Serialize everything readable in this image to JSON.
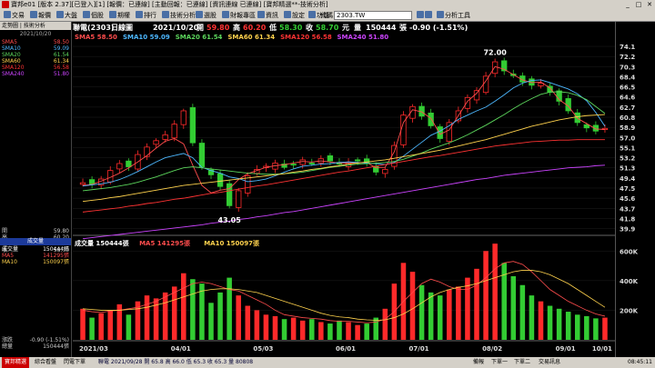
{
  "window": {
    "title": "寶邦e01 [版本 2.37][已登入][1] [報價：已連線] [主動回報：已連線] [資訊連線 已連線] [寶邦精選**-技術分析]"
  },
  "menu": [
    {
      "label": "交易"
    },
    {
      "label": "報價"
    },
    {
      "label": "大盤"
    },
    {
      "label": "個股"
    },
    {
      "label": "期權"
    },
    {
      "label": "排行"
    },
    {
      "label": "技術分析"
    },
    {
      "label": "選股"
    },
    {
      "label": "財報專區"
    },
    {
      "label": "資訊"
    },
    {
      "label": "設定"
    },
    {
      "label": "功能"
    }
  ],
  "toolbar": {
    "code_label": "代碼",
    "symbol_value": "2303.TW",
    "analysis_label": "分析工具"
  },
  "left_panel": {
    "tabs": "走勢圖 | 技術分析",
    "date": "2021/10/20",
    "ma_rows": [
      {
        "label": "SMA5",
        "value": "58.50",
        "color": "#ff4d4d"
      },
      {
        "label": "SMA10",
        "value": "59.09",
        "color": "#4db8ff"
      },
      {
        "label": "SMA20",
        "value": "61.54",
        "color": "#5cd65c"
      },
      {
        "label": "SMA60",
        "value": "61.34",
        "color": "#ffd24d"
      },
      {
        "label": "SMA120",
        "value": "56.58",
        "color": "#ff3333"
      },
      {
        "label": "SMA240",
        "value": "51.80",
        "color": "#cc44ff"
      }
    ],
    "ohlc_rows": [
      {
        "label": "開",
        "value": "59.80"
      },
      {
        "label": "高",
        "value": "60.20"
      },
      {
        "label": "低",
        "value": "58.30"
      },
      {
        "label": "收",
        "value": "58.70"
      }
    ],
    "vol_header": "成交量",
    "vol_rows": [
      {
        "label": "成交量",
        "value": "150444張",
        "color": "#ffffff"
      },
      {
        "label": "MA5",
        "value": "141295張",
        "color": "#ff4d4d"
      },
      {
        "label": "MA10",
        "value": "150097張",
        "color": "#ffd24d"
      }
    ],
    "footer_rows": [
      {
        "label": "漲跌",
        "value": "-0.90 (-1.51%)"
      },
      {
        "label": "總量",
        "value": "150444張"
      }
    ]
  },
  "chart_header": {
    "name": "聯電(2303)",
    "period": "日線圖",
    "date": "2021/10/20",
    "open_label": "開",
    "open": "59.80",
    "high_label": "高",
    "high": "60.20",
    "low_label": "低",
    "low": "58.30",
    "close_label": "收",
    "close": "58.70",
    "unit": "元",
    "vol_label": "量",
    "volume": "150444",
    "chg_label": "張",
    "change": "-0.90 (-1.51%)",
    "ma_legend": [
      {
        "label": "SMA5",
        "value": "58.50",
        "color": "#ff4d4d"
      },
      {
        "label": "SMA10",
        "value": "59.09",
        "color": "#4db8ff"
      },
      {
        "label": "SMA20",
        "value": "61.54",
        "color": "#5cd65c"
      },
      {
        "label": "SMA60",
        "value": "61.34",
        "color": "#ffd24d"
      },
      {
        "label": "SMA120",
        "value": "56.58",
        "color": "#ff3333"
      },
      {
        "label": "SMA240",
        "value": "51.80",
        "color": "#cc44ff"
      }
    ],
    "vol_legend": [
      {
        "label": "成交量",
        "value": "150444",
        "unit": "張",
        "color": "#ffffff"
      },
      {
        "label": "MA5",
        "value": "141295",
        "unit": "張",
        "color": "#ff4d4d"
      },
      {
        "label": "MA10",
        "value": "150097",
        "unit": "張",
        "color": "#ffd24d"
      }
    ]
  },
  "chart_data": [
    {
      "type": "candlestick",
      "yticks": [
        39.9,
        41.8,
        43.7,
        45.6,
        47.5,
        49.4,
        51.3,
        53.2,
        55.1,
        57.0,
        58.9,
        60.8,
        62.7,
        64.6,
        66.5,
        68.4,
        70.3,
        72.2,
        74.1
      ],
      "ylim": [
        38.8,
        75.3
      ],
      "annotations": [
        {
          "label": "72.00",
          "value": 72.0,
          "date": "2021/09/01"
        },
        {
          "label": "43.05",
          "value": 43.05,
          "date": "2021/05/13"
        }
      ],
      "xticks": [
        "2021/03",
        "04/01",
        "05/03",
        "06/01",
        "07/01",
        "08/02",
        "09/01",
        "10/01"
      ],
      "series": [
        {
          "name": "SMA5",
          "values": [
            48.0,
            48.2,
            48.8,
            49.5,
            50.3,
            51.3,
            52.4,
            53.6,
            55.0,
            56.3,
            56.8,
            55.8,
            51.8,
            48.0,
            46.6,
            47.1,
            47.4,
            49.1,
            50.2,
            50.8,
            51.4,
            51.7,
            51.9,
            52.2,
            52.5,
            52.4,
            52.6,
            52.4,
            52.2,
            52.2,
            52.3,
            52.3,
            51.3,
            51.4,
            54.3,
            59.8,
            62.2,
            61.8,
            60.6,
            57.6,
            58.4,
            61.1,
            63.8,
            65.3,
            67.6,
            70.3,
            69.8,
            68.8,
            67.8,
            67.3,
            67.4,
            66.3,
            64.1,
            62.9,
            60.6,
            59.6,
            58.6,
            58.5
          ]
        },
        {
          "name": "SMA10",
          "values": [
            47.9,
            48.1,
            48.3,
            48.6,
            49.1,
            49.8,
            50.6,
            51.5,
            52.4,
            53.2,
            53.6,
            54.0,
            53.2,
            51.4,
            50.8,
            50.3,
            49.6,
            49.3,
            48.7,
            48.9,
            49.2,
            49.8,
            50.5,
            51.1,
            51.6,
            51.8,
            52.0,
            52.1,
            52.3,
            52.4,
            52.3,
            52.2,
            52.1,
            51.9,
            52.3,
            53.5,
            54.8,
            56.1,
            57.4,
            58.2,
            59.2,
            60.4,
            61.2,
            62.0,
            62.7,
            63.8,
            65.0,
            66.3,
            67.2,
            67.7,
            67.8,
            67.3,
            66.7,
            66.1,
            65.2,
            63.9,
            61.7,
            59.1
          ]
        },
        {
          "name": "SMA20",
          "values": [
            47.0,
            47.2,
            47.4,
            47.6,
            47.9,
            48.2,
            48.6,
            49.1,
            49.6,
            50.2,
            50.8,
            51.3,
            51.5,
            51.3,
            51.1,
            50.9,
            50.7,
            50.5,
            50.3,
            50.2,
            50.1,
            50.1,
            50.2,
            50.3,
            50.5,
            50.8,
            51.1,
            51.4,
            51.6,
            51.8,
            52.0,
            52.1,
            52.2,
            52.3,
            52.5,
            52.9,
            53.5,
            54.1,
            54.8,
            55.4,
            56.0,
            56.7,
            57.5,
            58.4,
            59.3,
            60.3,
            61.3,
            62.4,
            63.4,
            64.3,
            65.1,
            65.5,
            65.6,
            65.4,
            64.9,
            64.1,
            62.8,
            61.5
          ]
        },
        {
          "name": "SMA60",
          "values": [
            45.0,
            45.2,
            45.4,
            45.7,
            45.9,
            46.2,
            46.5,
            46.8,
            47.1,
            47.4,
            47.7,
            48.0,
            48.2,
            48.4,
            48.6,
            48.8,
            49.0,
            49.2,
            49.4,
            49.6,
            49.8,
            50.0,
            50.2,
            50.5,
            50.7,
            51.0,
            51.2,
            51.5,
            51.7,
            52.0,
            52.2,
            52.4,
            52.6,
            52.8,
            53.1,
            53.4,
            53.7,
            54.0,
            54.3,
            54.6,
            55.0,
            55.4,
            55.8,
            56.2,
            56.6,
            57.1,
            57.6,
            58.1,
            58.6,
            59.1,
            59.5,
            59.9,
            60.3,
            60.6,
            60.9,
            61.1,
            61.2,
            61.3
          ]
        },
        {
          "name": "SMA120",
          "values": [
            43.0,
            43.2,
            43.4,
            43.6,
            43.8,
            44.1,
            44.3,
            44.6,
            44.8,
            45.1,
            45.4,
            45.6,
            45.9,
            46.2,
            46.5,
            46.7,
            47.0,
            47.3,
            47.6,
            47.9,
            48.1,
            48.4,
            48.7,
            49.0,
            49.3,
            49.6,
            49.9,
            50.2,
            50.5,
            50.7,
            51.0,
            51.3,
            51.6,
            51.9,
            52.2,
            52.5,
            52.8,
            53.1,
            53.4,
            53.6,
            53.9,
            54.2,
            54.5,
            54.8,
            55.1,
            55.4,
            55.6,
            55.8,
            56.0,
            56.2,
            56.3,
            56.4,
            56.5,
            56.5,
            56.6,
            56.6,
            56.6,
            56.6
          ]
        },
        {
          "name": "SMA240",
          "values": [
            38.0,
            38.2,
            38.4,
            38.6,
            38.8,
            39.0,
            39.2,
            39.4,
            39.6,
            39.8,
            40.0,
            40.2,
            40.4,
            40.6,
            40.9,
            41.1,
            41.3,
            41.6,
            41.8,
            42.1,
            42.3,
            42.6,
            42.9,
            43.1,
            43.4,
            43.7,
            44.0,
            44.3,
            44.6,
            44.9,
            45.2,
            45.5,
            45.8,
            46.1,
            46.4,
            46.7,
            47.0,
            47.3,
            47.6,
            47.9,
            48.2,
            48.5,
            48.8,
            49.1,
            49.3,
            49.6,
            49.9,
            50.1,
            50.3,
            50.5,
            50.7,
            50.9,
            51.1,
            51.3,
            51.4,
            51.5,
            51.7,
            51.8
          ]
        }
      ],
      "close": [
        48.5,
        48.2,
        49.2,
        50.8,
        52.1,
        51.5,
        53.8,
        55.2,
        56.4,
        57.5,
        59.5,
        62.0,
        56.0,
        51.5,
        50.0,
        47.8,
        44.2,
        47.0,
        49.8,
        51.0,
        51.6,
        52.2,
        51.4,
        51.9,
        52.8,
        52.1,
        53.0,
        52.6,
        52.0,
        52.4,
        52.6,
        52.1,
        50.5,
        51.0,
        55.5,
        61.2,
        62.8,
        61.0,
        59.2,
        56.8,
        59.8,
        62.0,
        64.5,
        65.8,
        68.5,
        71.2,
        69.5,
        68.6,
        67.4,
        66.8,
        67.2,
        65.5,
        63.8,
        62.0,
        59.8,
        58.8,
        58.2,
        58.7
      ]
    },
    {
      "type": "bar",
      "name": "成交量",
      "yticks": [
        "200K",
        "400K",
        "600K"
      ],
      "ylim": [
        0,
        700
      ],
      "values": [
        210,
        150,
        180,
        200,
        240,
        170,
        260,
        300,
        280,
        320,
        360,
        450,
        410,
        380,
        250,
        320,
        420,
        300,
        230,
        200,
        170,
        160,
        140,
        150,
        130,
        140,
        120,
        110,
        130,
        120,
        100,
        110,
        150,
        210,
        380,
        520,
        460,
        370,
        320,
        300,
        340,
        360,
        420,
        480,
        600,
        650,
        520,
        430,
        370,
        300,
        260,
        230,
        210,
        190,
        170,
        160,
        145,
        150
      ],
      "ma5": [
        200,
        190,
        185,
        195,
        200,
        210,
        220,
        240,
        260,
        290,
        320,
        350,
        380,
        390,
        380,
        360,
        340,
        330,
        300,
        270,
        240,
        200,
        170,
        160,
        150,
        145,
        140,
        130,
        125,
        125,
        120,
        115,
        120,
        140,
        190,
        260,
        320,
        380,
        410,
        390,
        360,
        340,
        340,
        370,
        420,
        480,
        520,
        530,
        510,
        460,
        400,
        340,
        300,
        260,
        230,
        200,
        175,
        160
      ],
      "ma10": [
        210,
        205,
        200,
        200,
        200,
        205,
        210,
        220,
        235,
        250,
        270,
        290,
        310,
        330,
        340,
        345,
        345,
        340,
        330,
        320,
        300,
        280,
        260,
        240,
        220,
        200,
        180,
        165,
        155,
        150,
        140,
        135,
        132,
        135,
        150,
        175,
        210,
        250,
        290,
        320,
        340,
        355,
        365,
        380,
        400,
        420,
        440,
        460,
        470,
        470,
        460,
        440,
        410,
        380,
        340,
        300,
        260,
        220
      ]
    }
  ],
  "status": {
    "tab1": "寶邦精選",
    "tab2": "綜合看盤",
    "tab3": "閃電下單",
    "ticker": "聯電 2021/09/28 開 65.8 高 66.0 低 65.3 收 65.3 量 80808",
    "btn1": "備報",
    "btn2": "下單一",
    "btn3": "下單二",
    "btn4": "交易訊息",
    "clock": "08:45:11"
  }
}
